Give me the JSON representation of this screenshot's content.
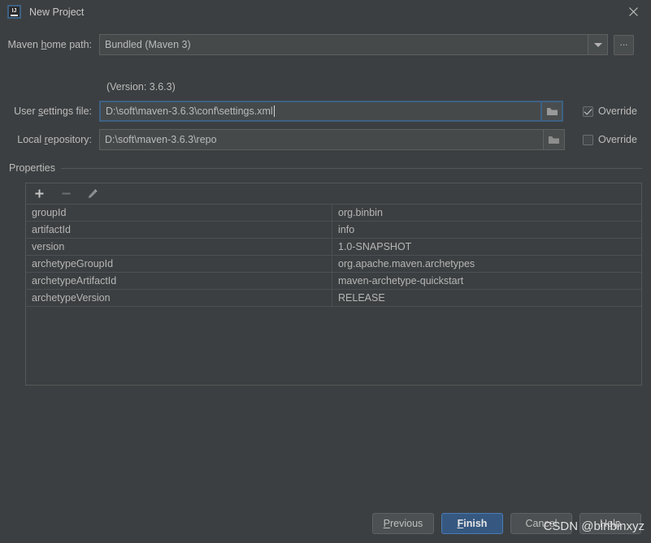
{
  "window": {
    "title": "New Project",
    "app_icon": "intellij-idea-icon",
    "close_icon": "close-icon"
  },
  "form": {
    "maven_home": {
      "label_prefix": "Maven ",
      "label_mnemonic": "h",
      "label_suffix": "ome path:",
      "value": "Bundled (Maven 3)",
      "dropdown_icon": "chevron-down-icon",
      "browse_label": "...",
      "version_note": "(Version: 3.6.3)"
    },
    "user_settings": {
      "label_prefix": "User ",
      "label_mnemonic": "s",
      "label_suffix": "ettings file:",
      "value": "D:\\soft\\maven-3.6.3\\conf\\settings.xml",
      "folder_icon": "folder-icon",
      "override_label": "Override",
      "override_checked": true
    },
    "local_repository": {
      "label_prefix": "Local ",
      "label_mnemonic": "r",
      "label_suffix": "epository:",
      "value": "D:\\soft\\maven-3.6.3\\repo",
      "folder_icon": "folder-icon",
      "override_label": "Override",
      "override_checked": false
    }
  },
  "properties": {
    "group_title": "Properties",
    "toolbar": {
      "add_icon": "plus-icon",
      "remove_icon": "minus-icon",
      "edit_icon": "pencil-icon"
    },
    "rows": [
      {
        "key": "groupId",
        "value": "org.binbin"
      },
      {
        "key": "artifactId",
        "value": "info"
      },
      {
        "key": "version",
        "value": "1.0-SNAPSHOT"
      },
      {
        "key": "archetypeGroupId",
        "value": "org.apache.maven.archetypes"
      },
      {
        "key": "archetypeArtifactId",
        "value": "maven-archetype-quickstart"
      },
      {
        "key": "archetypeVersion",
        "value": "RELEASE"
      }
    ]
  },
  "buttons": {
    "previous": {
      "prefix": "",
      "mnemonic": "P",
      "suffix": "revious"
    },
    "finish": {
      "prefix": "",
      "mnemonic": "F",
      "suffix": "inish"
    },
    "cancel": {
      "prefix": "Cancel",
      "mnemonic": "",
      "suffix": ""
    },
    "help": {
      "prefix": "Help",
      "mnemonic": "",
      "suffix": ""
    }
  },
  "watermark": {
    "text": "CSDN @binbinxyz"
  },
  "colors": {
    "background": "#3c3f41",
    "field_background": "#45494a",
    "focus_border": "#3d6185",
    "default_button": "#365880",
    "text": "#bbbbbb"
  }
}
